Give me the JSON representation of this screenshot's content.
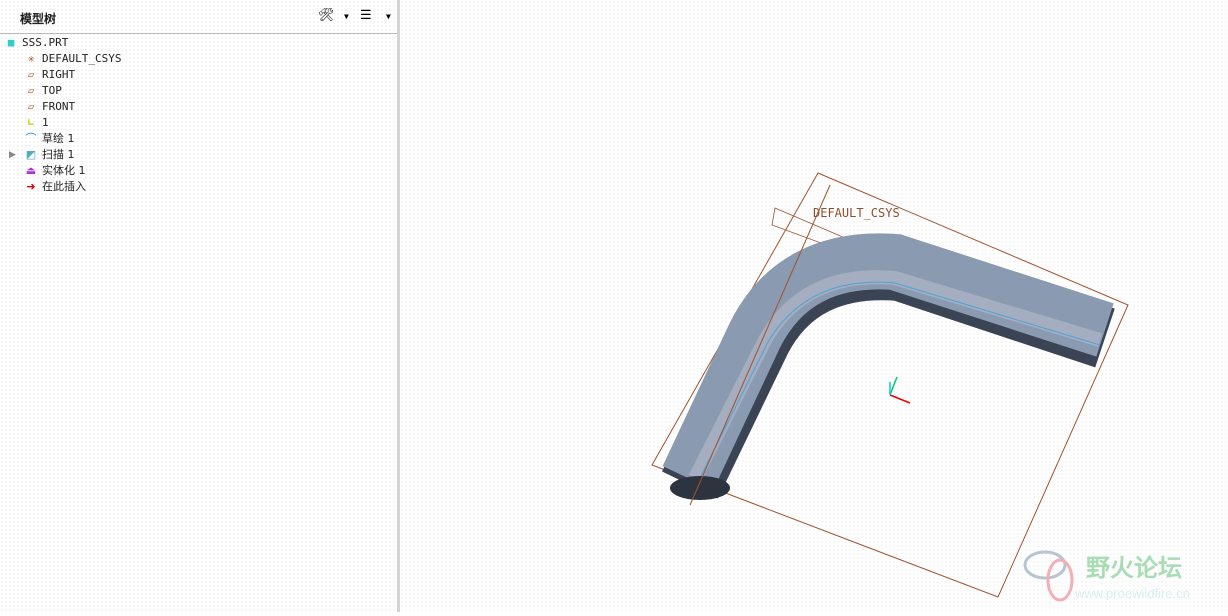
{
  "panel": {
    "title": "模型树"
  },
  "tree": [
    {
      "label": "SSS.PRT",
      "icon": "part-icon"
    },
    {
      "label": "DEFAULT_CSYS",
      "icon": "csys-icon"
    },
    {
      "label": "RIGHT",
      "icon": "datum-plane-icon"
    },
    {
      "label": "TOP",
      "icon": "datum-plane-icon"
    },
    {
      "label": "FRONT",
      "icon": "datum-plane-icon"
    },
    {
      "label": "1",
      "icon": "datum-curve-icon"
    },
    {
      "label": "草绘 1",
      "icon": "sketch-icon"
    },
    {
      "label": "扫描 1",
      "icon": "sweep-icon"
    },
    {
      "label": "实体化 1",
      "icon": "solidify-icon"
    },
    {
      "label": "在此插入",
      "icon": "insert-here-icon"
    }
  ],
  "viewport": {
    "csys_label": "DEFAULT_CSYS",
    "watermark_cn": "野火论坛",
    "watermark_url": "www.proewildfire.cn"
  }
}
